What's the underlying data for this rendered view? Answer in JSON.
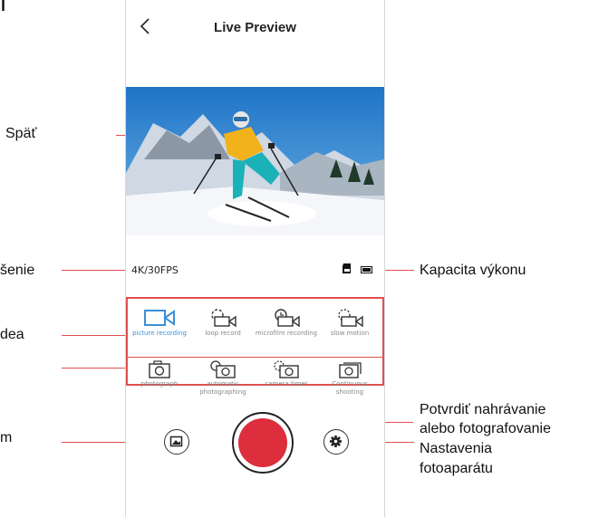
{
  "header": {
    "title": "Live Preview",
    "back_icon": "chevron-left-icon"
  },
  "status": {
    "resolution": "4K/30FPS",
    "sd_icon": "sd-card-icon",
    "battery_icon": "battery-icon"
  },
  "modes": {
    "video": [
      {
        "label": "picture recording",
        "icon": "video-camera-icon",
        "active": true
      },
      {
        "label": "loop record",
        "icon": "loop-video-icon"
      },
      {
        "label": "microfilm recording",
        "icon": "microfilm-icon"
      },
      {
        "label": "slow motion",
        "icon": "slow-motion-icon"
      }
    ],
    "photo": [
      {
        "label": "photograph",
        "icon": "camera-icon"
      },
      {
        "label": "automatic photographing",
        "icon": "auto-photo-icon"
      },
      {
        "label": "camera timer",
        "icon": "timer-camera-icon"
      },
      {
        "label": "Continuous shooting",
        "icon": "burst-camera-icon"
      }
    ]
  },
  "controls": {
    "gallery_icon": "gallery-icon",
    "shutter_icon": "shutter-icon",
    "settings_icon": "gear-icon"
  },
  "callouts": {
    "title_fragment": "l",
    "back": "Späť",
    "resolution": "šenie",
    "video": "dea",
    "gallery": "m",
    "capacity": "Kapacita výkonu",
    "confirm_line1": "Potvrdiť nahrávanie",
    "confirm_line2": "alebo fotografovanie",
    "settings_line1": "Nastavenia",
    "settings_line2": "fotoaparátu"
  },
  "colors": {
    "accent_line": "#e05050",
    "shutter": "#dc2e3c",
    "active_mode": "#3b8fd8"
  }
}
